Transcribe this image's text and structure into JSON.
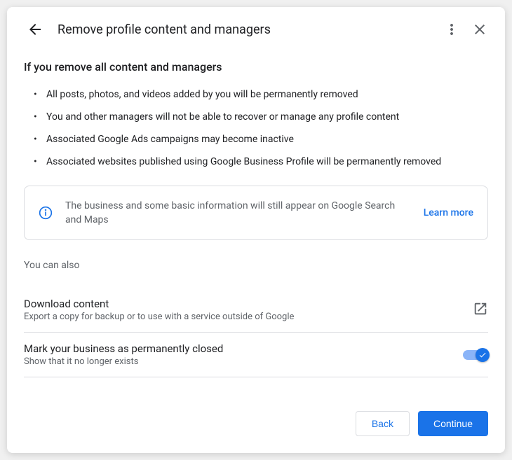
{
  "header": {
    "title": "Remove profile content and managers"
  },
  "section": {
    "heading": "If you remove all content and managers",
    "bullets": [
      "All posts, photos, and videos added by you will be permanently removed",
      "You and other managers will not be able to recover or manage any profile content",
      "Associated Google Ads campaigns may become inactive",
      "Associated websites published using Google Business Profile will be permanently removed"
    ]
  },
  "info": {
    "text": "The business and some basic information will still appear on Google Search and Maps",
    "link": "Learn more"
  },
  "subheading": "You can also",
  "options": {
    "download": {
      "title": "Download content",
      "desc": "Export a copy for backup or to use with a service outside of Google"
    },
    "closed": {
      "title": "Mark your business as permanently closed",
      "desc": "Show that it no longer exists"
    }
  },
  "footer": {
    "back": "Back",
    "continue": "Continue"
  }
}
